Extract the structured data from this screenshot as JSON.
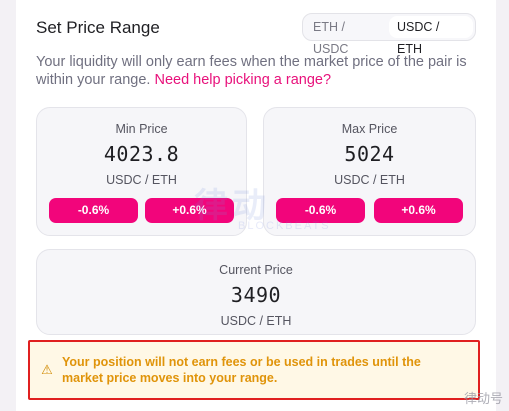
{
  "header": {
    "title": "Set Price Range",
    "toggle_options": [
      {
        "label": "ETH / USDC",
        "active": false
      },
      {
        "label": "USDC / ETH",
        "active": true
      }
    ]
  },
  "description": {
    "text": "Your liquidity will only earn fees when the market price of the pair is within your range.",
    "help_link": "Need help picking a range?"
  },
  "min_price": {
    "label": "Min Price",
    "value": "4023.8",
    "unit": "USDC / ETH",
    "decrease": "-0.6%",
    "increase": "+0.6%"
  },
  "max_price": {
    "label": "Max Price",
    "value": "5024",
    "unit": "USDC / ETH",
    "decrease": "-0.6%",
    "increase": "+0.6%"
  },
  "current_price": {
    "label": "Current Price",
    "value": "3490",
    "unit": "USDC / ETH"
  },
  "warning": {
    "text": "Your position will not earn fees or be used in trades until the market price moves into your range."
  },
  "watermark": {
    "main": "律动",
    "sub": "BLOCKBEATS",
    "corner": "律动号"
  },
  "colors": {
    "accent": "#f2057b",
    "link": "#e8117b",
    "warning_text": "#e0940a",
    "highlight_border": "#e02020"
  }
}
